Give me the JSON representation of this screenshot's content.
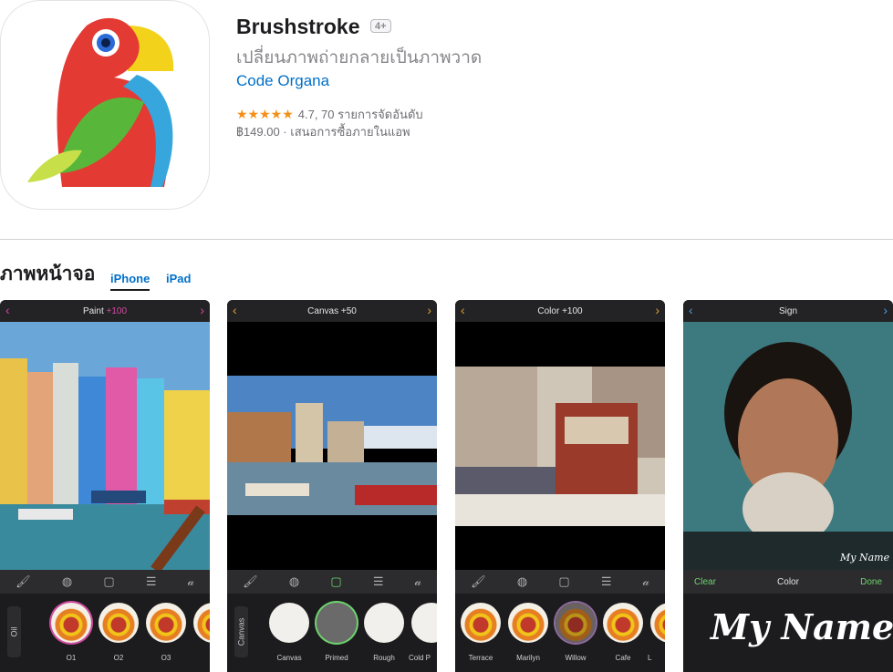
{
  "app": {
    "name": "Brushstroke",
    "age_rating": "4+",
    "subtitle": "เปลี่ยนภาพถ่ายกลายเป็นภาพวาด",
    "developer": "Code Organa",
    "stars": "★★★★★",
    "rating_text": "4.7, 70 รายการจัดอันดับ",
    "price_text": "฿149.00 · เสนอการซื้อภายในแอพ"
  },
  "screenshots_section": {
    "title": "ภาพหน้าจอ",
    "tabs": [
      "iPhone",
      "iPad"
    ]
  },
  "screens": [
    {
      "title": "Paint",
      "title_accent": "+100",
      "tray_label": "Oil",
      "thumbs": [
        "O1",
        "O2",
        "O3"
      ]
    },
    {
      "title": "Canvas +50",
      "tray_label": "Canvas",
      "thumbs": [
        "Canvas",
        "Primed",
        "Rough",
        "Cold P"
      ]
    },
    {
      "title": "Color +100",
      "thumbs": [
        "Terrace",
        "Marilyn",
        "Willow",
        "Cafe",
        "L"
      ]
    },
    {
      "title": "Sign",
      "clear": "Clear",
      "color": "Color",
      "done": "Done",
      "watermark": "My Name",
      "signature": "My Name"
    }
  ],
  "icons": {
    "toolbar": [
      "brush-icon",
      "palette-icon",
      "canvas-easel-icon",
      "sliders-icon",
      "signature-icon"
    ]
  }
}
